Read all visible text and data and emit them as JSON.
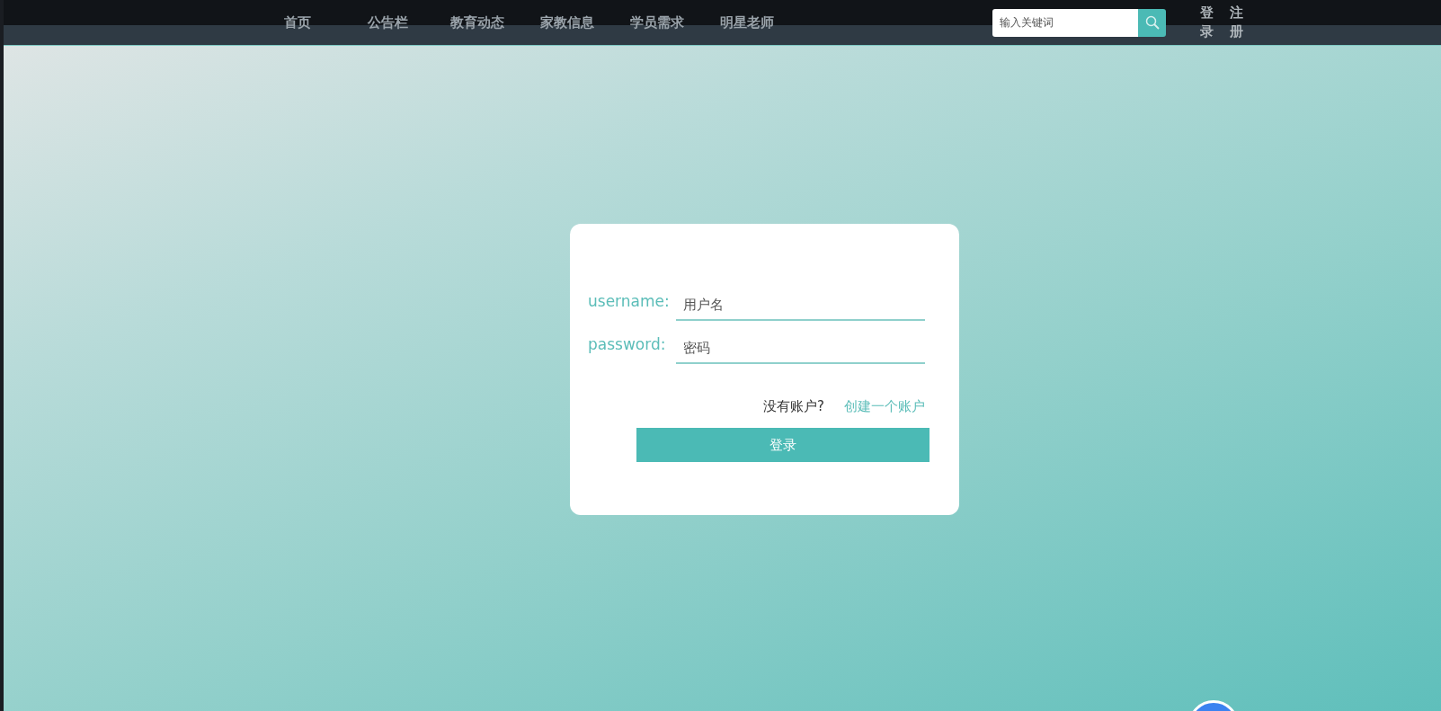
{
  "nav": {
    "items": [
      {
        "label": "首页"
      },
      {
        "label": "公告栏"
      },
      {
        "label": "教育动态"
      },
      {
        "label": "家教信息"
      },
      {
        "label": "学员需求"
      },
      {
        "label": "明星老师"
      }
    ],
    "search": {
      "placeholder": "输入关键词"
    },
    "auth_links": [
      {
        "label": "登录"
      },
      {
        "label": "注册"
      }
    ]
  },
  "login_form": {
    "fields": [
      {
        "label": "username:",
        "placeholder": "用户名"
      },
      {
        "label": "password:",
        "placeholder": "密码"
      }
    ],
    "no_account_text": "没有账户?",
    "create_account_link": "创建一个账户",
    "submit_button": "登录"
  }
}
